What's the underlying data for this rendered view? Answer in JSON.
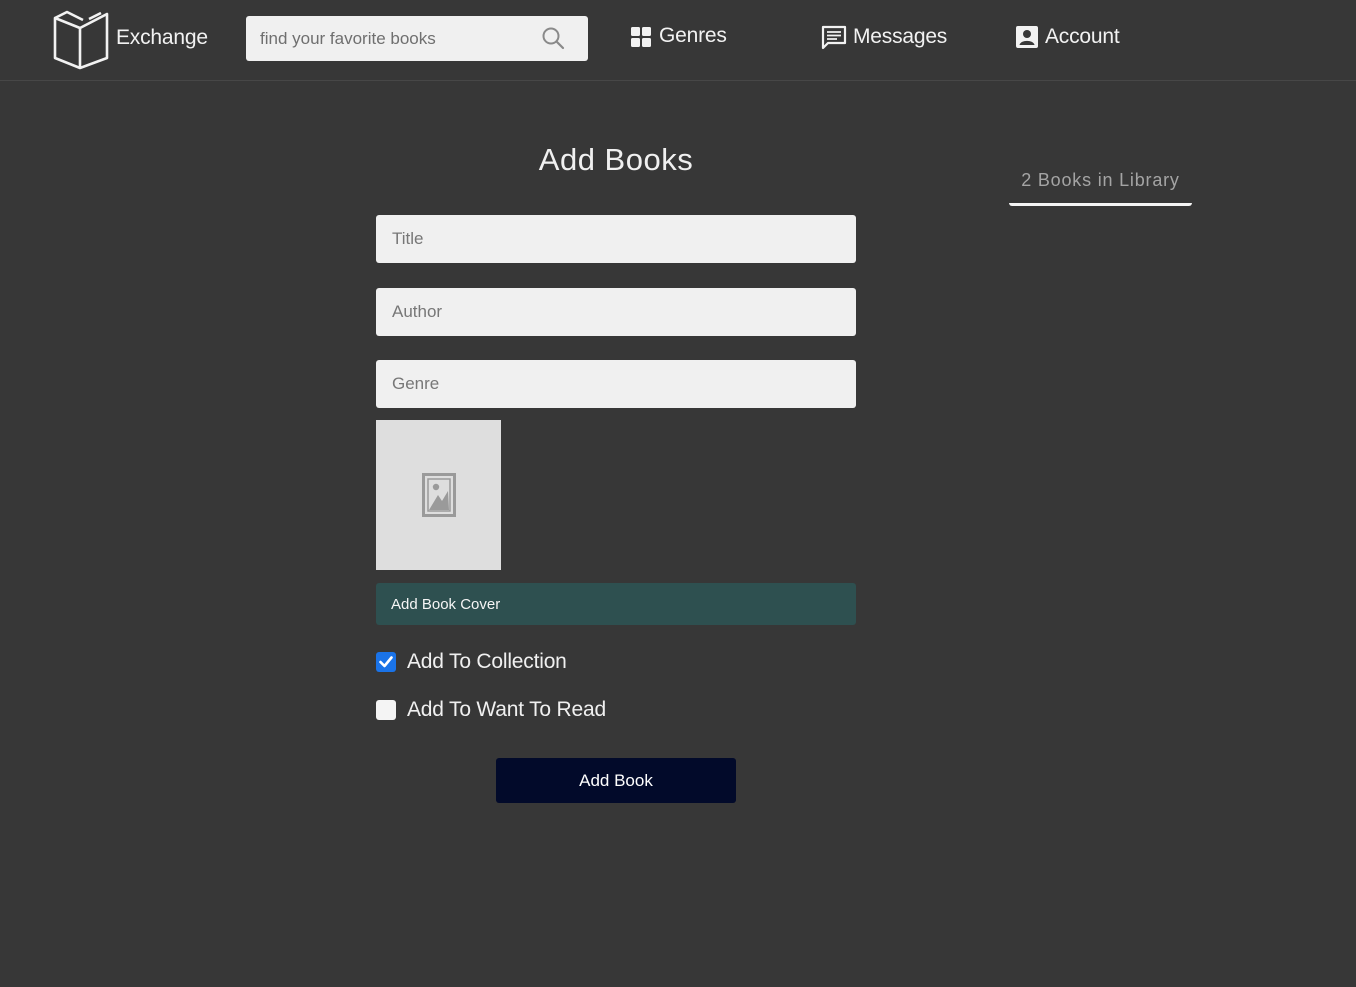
{
  "navbar": {
    "brand": "Exchange",
    "search": {
      "placeholder": "find your favorite books",
      "value": ""
    },
    "links": [
      {
        "label": "Genres",
        "icon": "grid-icon"
      },
      {
        "label": "Messages",
        "icon": "message-icon"
      },
      {
        "label": "Account",
        "icon": "account-icon"
      }
    ]
  },
  "main": {
    "title": "Add Books",
    "fields": [
      {
        "placeholder": "Title",
        "value": ""
      },
      {
        "placeholder": "Author",
        "value": ""
      },
      {
        "placeholder": "Genre",
        "value": ""
      }
    ],
    "cover": {
      "icon": "image-placeholder-icon",
      "button_label": "Add Book Cover"
    },
    "checkboxes": [
      {
        "label": "Add To Collection",
        "checked": true
      },
      {
        "label": "Add To Want To Read",
        "checked": false
      }
    ],
    "submit_label": "Add Book"
  },
  "sidebar": {
    "library_count": "2 Books in Library"
  },
  "colors": {
    "background": "#373737",
    "cover_button": "#2e5050",
    "submit_button": "#020a2a",
    "checkbox_checked": "#1a73e8"
  }
}
